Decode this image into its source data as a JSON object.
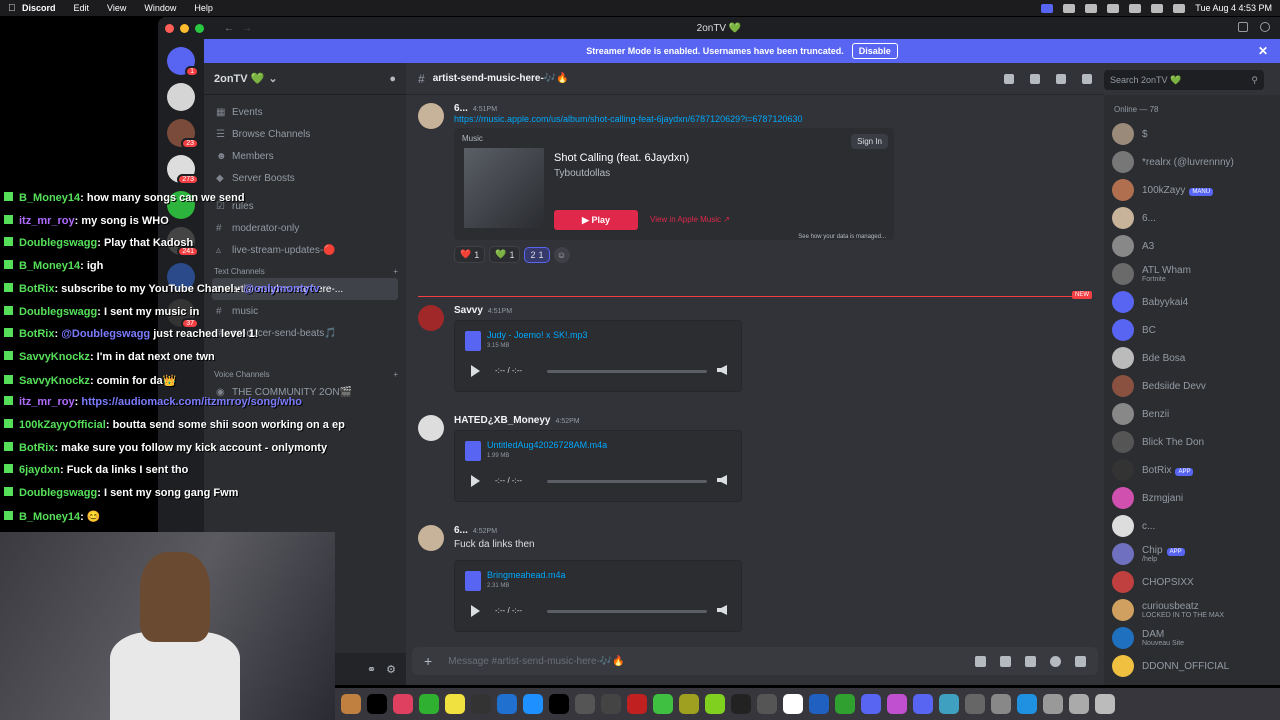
{
  "menubar": {
    "app": "Discord",
    "items": [
      "Edit",
      "View",
      "Window",
      "Help"
    ],
    "clock": "Tue Aug 4  4:53 PM"
  },
  "window": {
    "title": "2onTV 💚"
  },
  "banner": {
    "text": "Streamer Mode is enabled. Usernames have been truncated.",
    "button": "Disable"
  },
  "guild_badges": [
    "1",
    "",
    "23",
    "273",
    "",
    "241",
    "",
    "37"
  ],
  "server": {
    "name": "2onTV 💚"
  },
  "nav": [
    "Events",
    "Browse Channels",
    "Members",
    "Server Boosts"
  ],
  "channels_top": [
    "rules",
    "moderator-only",
    "live-stream-updates-🔴"
  ],
  "text_category": "Text Channels",
  "channels_text": [
    "artist-send-music-here-...",
    "music",
    "producer-send-beats🎵"
  ],
  "voice_category": "Voice Channels",
  "voice_channels": [
    "THE COMMUNITY 2ON🎬"
  ],
  "chat": {
    "channel": "artist-send-music-here-🎶🔥",
    "search_placeholder": "Search 2onTV 💚",
    "composer_placeholder": "Message #artist-send-music-here-🎶🔥",
    "new_label": "NEW",
    "messages": [
      {
        "author": "6...",
        "time": "4:51PM",
        "link": "https://music.apple.com/us/album/shot-calling-feat-6jaydxn/6787120629?i=6787120630",
        "embed": {
          "source": "Music",
          "song": "Shot Calling (feat. 6Jaydxn)",
          "artist": "Tyboutdollas",
          "sign_in": "Sign In",
          "play": "Play",
          "listen": "View in Apple Music ↗",
          "footer": "See how your data is managed..."
        },
        "reactions": [
          {
            "emoji": "❤️",
            "count": "1"
          },
          {
            "emoji": "💚",
            "count": "1"
          },
          {
            "emoji": "2",
            "count": "1"
          }
        ]
      },
      {
        "author": "Savvy",
        "time": "4:51PM",
        "file": "Judy - Joemo! x SK!.mp3",
        "size": "3.15 MB",
        "timer": "-:-- / -:--"
      },
      {
        "author": "HATED¿XB_Moneyy",
        "time": "4:52PM",
        "file": "UntitledAug42026728AM.m4a",
        "size": "1.99 MB",
        "timer": "-:-- / -:--"
      },
      {
        "author": "6...",
        "time": "4:52PM",
        "text": "Fuck da links then",
        "file": "Bringmeahead.m4a",
        "size": "2.31 MB",
        "timer": "-:-- / -:--"
      }
    ]
  },
  "members": {
    "category": "Online — 78",
    "list": [
      {
        "name": "$",
        "sub": "",
        "tag": ""
      },
      {
        "name": "*realrx (@luvrennny)",
        "sub": "",
        "tag": ""
      },
      {
        "name": "100kZayy",
        "sub": "",
        "tag": "MANU"
      },
      {
        "name": "6...",
        "sub": "",
        "tag": ""
      },
      {
        "name": "A3",
        "sub": "",
        "tag": ""
      },
      {
        "name": "ATL Wham",
        "sub": "Fortnite",
        "tag": ""
      },
      {
        "name": "Babyykai4",
        "sub": "",
        "tag": ""
      },
      {
        "name": "BC",
        "sub": "",
        "tag": ""
      },
      {
        "name": "Bde Bosa",
        "sub": "",
        "tag": ""
      },
      {
        "name": "Bedsiide Devv",
        "sub": "",
        "tag": ""
      },
      {
        "name": "Benzii",
        "sub": "",
        "tag": ""
      },
      {
        "name": "Blick The Don",
        "sub": "",
        "tag": ""
      },
      {
        "name": "BotRix",
        "sub": "",
        "tag": "APP"
      },
      {
        "name": "Bzmgjani",
        "sub": "",
        "tag": ""
      },
      {
        "name": "c...",
        "sub": "",
        "tag": ""
      },
      {
        "name": "Chip",
        "sub": "/help",
        "tag": "APP"
      },
      {
        "name": "CHOPSIXX",
        "sub": "",
        "tag": ""
      },
      {
        "name": "curiousbeatz",
        "sub": "LOCKED IN TO THE MAX",
        "tag": ""
      },
      {
        "name": "DAM",
        "sub": "Nouveau Site",
        "tag": ""
      },
      {
        "name": "DDONN_OFFICIAL",
        "sub": "",
        "tag": ""
      }
    ]
  },
  "overlay": [
    {
      "user": "B_Money14",
      "text": ": how many songs can we send",
      "purple": false
    },
    {
      "user": "itz_mr_roy",
      "text": ": my song is WHO",
      "purple": true
    },
    {
      "user": "Doublegswagg",
      "text": ": Play that Kadosh",
      "purple": false
    },
    {
      "user": "B_Money14",
      "text": ": igh",
      "purple": false
    },
    {
      "user": "BotRix",
      "text": ": subscribe to my YouTube Chanel - ",
      "link": "@onlymontytv",
      "purple": false
    },
    {
      "user": "Doublegswagg",
      "text": ": I sent my music in",
      "purple": false
    },
    {
      "user": "BotRix",
      "text": ": ",
      "link": "@Doublegswagg",
      "tail": " just reached level 1!",
      "purple": false
    },
    {
      "user": "SavvyKnockz",
      "text": ": I'm in dat next one twn",
      "purple": false
    },
    {
      "user": "SavvyKnockz",
      "text": ": comin for da👑",
      "purple": false
    },
    {
      "user": "itz_mr_roy",
      "text": ": ",
      "link": "https://audiomack.com/itzmrroy/song/who",
      "purple": true
    },
    {
      "user": "100kZayyOfficial",
      "text": ": boutta send some shii soon working on a ep",
      "purple": false
    },
    {
      "user": "BotRix",
      "text": ": make sure you follow my kick account - onlymonty",
      "purple": false
    },
    {
      "user": "6jaydxn",
      "text": ": Fuck da links I sent tho",
      "purple": false
    },
    {
      "user": "Doublegswagg",
      "text": ": I sent my song gang Fwm",
      "purple": false
    },
    {
      "user": "B_Money14",
      "text": ": 😊",
      "purple": false
    }
  ]
}
